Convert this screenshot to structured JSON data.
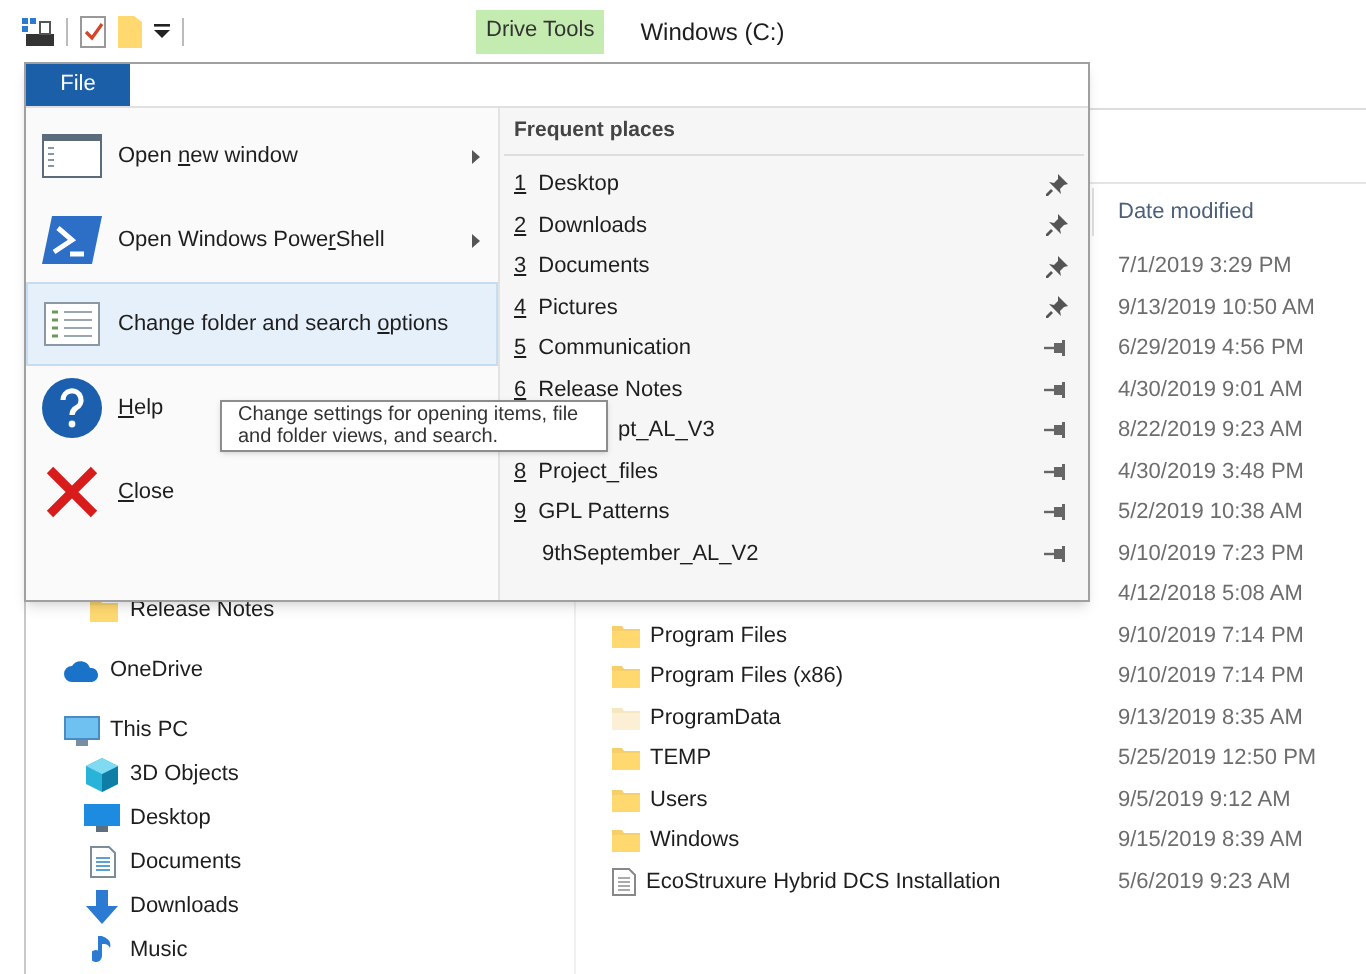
{
  "quick_access_toolbar": {
    "items": [
      {
        "kind": "properties"
      },
      {
        "kind": "checkmark"
      },
      {
        "kind": "folder"
      },
      {
        "kind": "dropdown"
      }
    ]
  },
  "title_bar": {
    "context_tab": "Drive Tools",
    "title": "Windows (C:)"
  },
  "file_menu": {
    "tab": "File",
    "commands": [
      {
        "kind": "window",
        "label_start": "Open ",
        "access_key": "n",
        "label_end": "ew window",
        "submenu": true,
        "selected": false
      },
      {
        "kind": "powershell",
        "label_start": "Open Windows Powe",
        "access_key": "r",
        "label_end": "Shell",
        "submenu": true,
        "selected": false
      },
      {
        "kind": "options",
        "label_start": "Change folder and search ",
        "access_key": "o",
        "label_end": "ptions",
        "submenu": false,
        "selected": true
      },
      {
        "kind": "help",
        "access_key": "H",
        "label_end": "elp",
        "submenu": false,
        "selected": false
      },
      {
        "kind": "close",
        "access_key": "C",
        "label_end": "lose",
        "submenu": false,
        "selected": false
      }
    ],
    "frequent_places": {
      "title": "Frequent places",
      "items": [
        {
          "number": "1",
          "label": "Desktop",
          "pinned": true
        },
        {
          "number": "2",
          "label": "Downloads",
          "pinned": true
        },
        {
          "number": "3",
          "label": "Documents",
          "pinned": true
        },
        {
          "number": "4",
          "label": "Pictures",
          "pinned": true
        },
        {
          "number": "5",
          "label": "Communication",
          "pinned": false
        },
        {
          "number": "6",
          "label": "Release Notes",
          "pinned": false
        },
        {
          "label": "pt_AL_V3",
          "pinned": false
        },
        {
          "number": "8",
          "label": "Project_files",
          "pinned": false
        },
        {
          "number": "9",
          "label": "GPL Patterns",
          "pinned": false
        },
        {
          "label": "9thSeptember_AL_V2",
          "pinned": false
        }
      ]
    }
  },
  "tooltip": "Change settings for opening items, file and folder views, and search.",
  "navigation_pane": {
    "quick_access_children": [
      {
        "kind": "folder",
        "label": "Release Notes"
      }
    ],
    "items": [
      {
        "kind": "cloud",
        "label": "OneDrive"
      },
      {
        "kind": "pc",
        "label": "This PC",
        "children": [
          {
            "kind": "cube",
            "label": "3D Objects"
          },
          {
            "kind": "desktop",
            "label": "Desktop"
          },
          {
            "kind": "document",
            "label": "Documents"
          },
          {
            "kind": "download",
            "label": "Downloads"
          },
          {
            "kind": "music",
            "label": "Music"
          }
        ]
      }
    ]
  },
  "file_list": {
    "columns": [
      "Date modified"
    ],
    "rows": [
      {
        "date_modified": "7/1/2019 3:29 PM"
      },
      {
        "date_modified": "9/13/2019 10:50 AM"
      },
      {
        "date_modified": "6/29/2019 4:56 PM"
      },
      {
        "date_modified": "4/30/2019 9:01 AM"
      },
      {
        "date_modified": "8/22/2019 9:23 AM"
      },
      {
        "date_modified": "4/30/2019 3:48 PM"
      },
      {
        "date_modified": "5/2/2019 10:38 AM"
      },
      {
        "date_modified": "9/10/2019 7:23 PM"
      },
      {
        "date_modified": "4/12/2018 5:08 AM"
      },
      {
        "kind": "folder",
        "name": "Program Files",
        "date_modified": "9/10/2019 7:14 PM"
      },
      {
        "kind": "folder",
        "name": "Program Files (x86)",
        "date_modified": "9/10/2019 7:14 PM"
      },
      {
        "kind": "hidden-folder",
        "name": "ProgramData",
        "date_modified": "9/13/2019 8:35 AM"
      },
      {
        "kind": "folder",
        "name": "TEMP",
        "date_modified": "5/25/2019 12:50 PM"
      },
      {
        "kind": "folder",
        "name": "Users",
        "date_modified": "9/5/2019 9:12 AM"
      },
      {
        "kind": "folder",
        "name": "Windows",
        "date_modified": "9/15/2019 8:39 AM"
      },
      {
        "kind": "file",
        "name": "EcoStruxure Hybrid DCS Installation",
        "date_modified": "5/6/2019 9:23 AM"
      }
    ]
  }
}
